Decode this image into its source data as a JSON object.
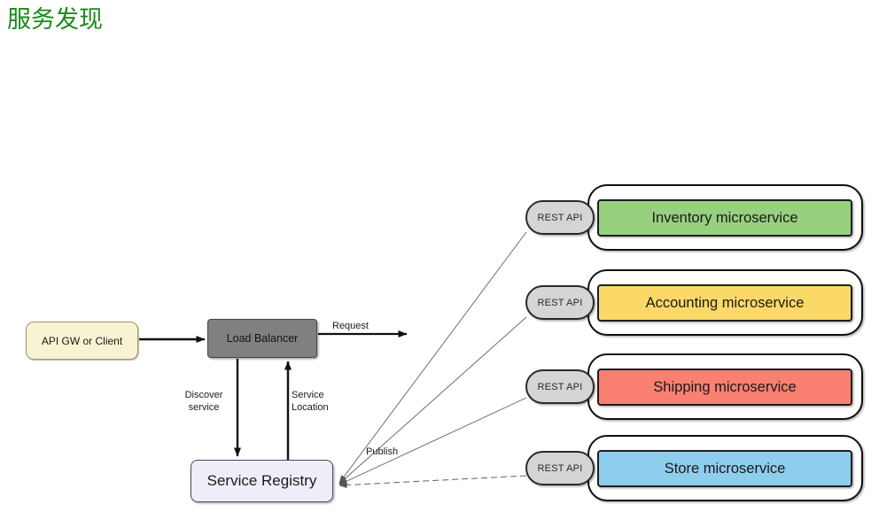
{
  "page": {
    "title": "服务发现",
    "title_color": "#1a8a1a",
    "background": "#ffffff"
  },
  "nodes": {
    "api_gateway": {
      "label": "API GW or Client",
      "fill": "#faf3d3",
      "stroke": "#a09a60"
    },
    "load_balancer": {
      "label": "Load Balancer",
      "fill": "#808080",
      "stroke": "#444444"
    },
    "service_registry": {
      "label": "Service Registry",
      "fill": "#eeeef8",
      "stroke": "#4a4a5a"
    }
  },
  "microservices": [
    {
      "api_label": "REST API",
      "label": "Inventory microservice",
      "fill": "#97d07e",
      "stroke": "#1e1e1e"
    },
    {
      "api_label": "REST API",
      "label": "Accounting microservice",
      "fill": "#fbd968",
      "stroke": "#1e1e1e"
    },
    {
      "api_label": "REST API",
      "label": "Shipping microservice",
      "fill": "#fa8072",
      "stroke": "#1e1e1e"
    },
    {
      "api_label": "REST API",
      "label": "Store microservice",
      "fill": "#8fcded",
      "stroke": "#1e1e1e"
    }
  ],
  "edges": {
    "request": "Request",
    "discover_service": "Discover\nservice",
    "service_location": "Service\nLocation",
    "publish": "Publish"
  }
}
